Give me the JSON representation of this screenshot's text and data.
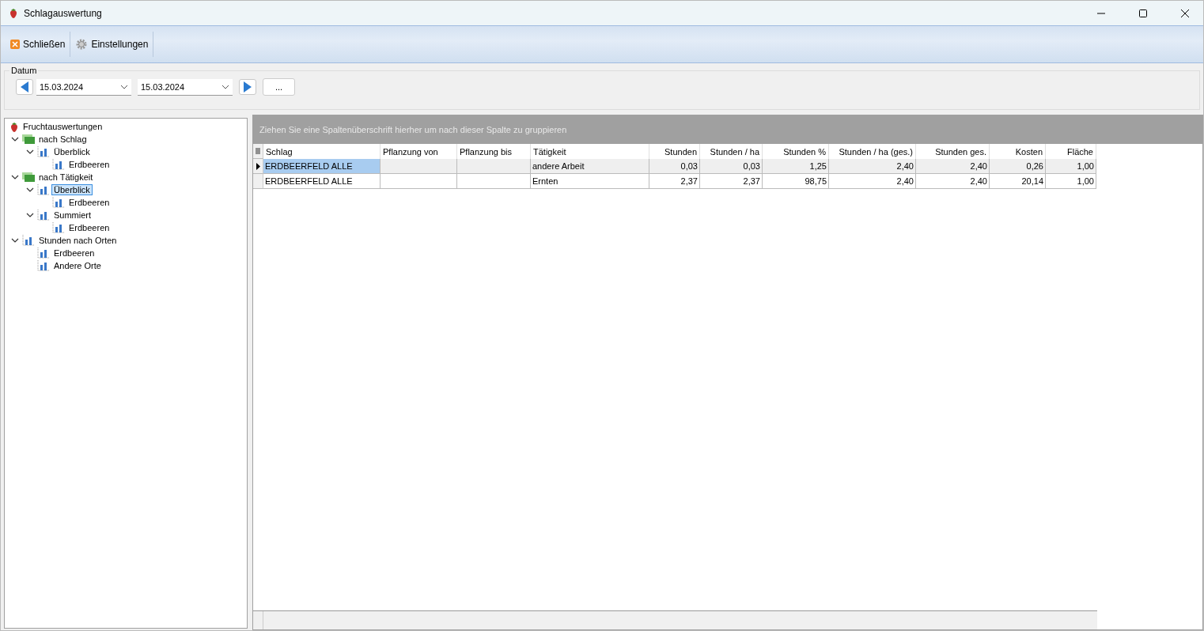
{
  "window": {
    "title": "Schlagauswertung"
  },
  "toolbar": [
    {
      "label": "Schließen",
      "kind": "close"
    },
    {
      "label": "Einstellungen",
      "kind": "settings"
    }
  ],
  "date_range": {
    "label": "Datum",
    "from": "15.03.2024",
    "to": "15.03.2024",
    "more": "..."
  },
  "tree": [
    {
      "label": "Fruchtauswertungen",
      "kind": "root",
      "selected": false,
      "children": [
        {
          "label": "nach Schlag",
          "kind": "group",
          "selected": false,
          "expanded": true,
          "children": [
            {
              "label": "Überblick",
              "kind": "report",
              "selected": false,
              "expanded": true,
              "children": [
                {
                  "label": "Erdbeeren",
                  "kind": "report",
                  "selected": false
                }
              ]
            }
          ]
        },
        {
          "label": "nach Tätigkeit",
          "kind": "group",
          "selected": false,
          "expanded": true,
          "children": [
            {
              "label": "Überblick",
              "kind": "report",
              "selected": true,
              "expanded": true,
              "children": [
                {
                  "label": "Erdbeeren",
                  "kind": "report",
                  "selected": false
                }
              ]
            },
            {
              "label": "Summiert",
              "kind": "report",
              "selected": false,
              "expanded": true,
              "children": [
                {
                  "label": "Erdbeeren",
                  "kind": "report",
                  "selected": false
                }
              ]
            }
          ]
        },
        {
          "label": "Stunden nach Orten",
          "kind": "report",
          "selected": false,
          "expanded": true,
          "children": [
            {
              "label": "Erdbeeren",
              "kind": "report",
              "selected": false
            },
            {
              "label": "Andere Orte",
              "kind": "report",
              "selected": false
            }
          ]
        }
      ]
    }
  ],
  "grid": {
    "group_hint": "Ziehen Sie eine Spaltenüberschrift hierher um nach dieser Spalte zu gruppieren",
    "columns": [
      "Schlag",
      "Pflanzung von",
      "Pflanzung bis",
      "Tätigkeit",
      "Stunden",
      "Stunden / ha",
      "Stunden %",
      "Stunden / ha (ges.)",
      "Stunden ges.",
      "Kosten",
      "Fläche"
    ],
    "rows": [
      {
        "selected": true,
        "cells": [
          "ERDBEERFELD ALLE",
          "",
          "",
          "andere Arbeit",
          "0,03",
          "0,03",
          "1,25",
          "2,40",
          "2,40",
          "0,26",
          "1,00"
        ]
      },
      {
        "selected": false,
        "cells": [
          "ERDBEERFELD ALLE",
          "",
          "",
          "Ernten",
          "2,37",
          "2,37",
          "98,75",
          "2,40",
          "2,40",
          "20,14",
          "1,00"
        ]
      }
    ]
  }
}
